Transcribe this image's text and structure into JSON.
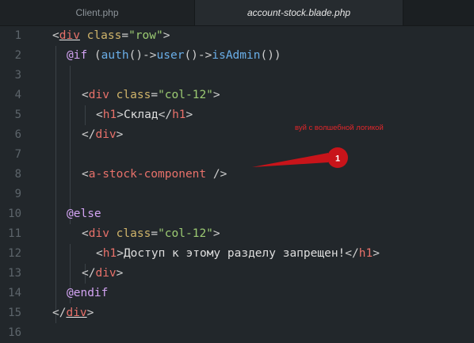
{
  "tabs": [
    {
      "label": "Client.php",
      "active": false
    },
    {
      "label": "account-stock.blade.php",
      "active": true
    }
  ],
  "line_numbers": [
    "1",
    "2",
    "3",
    "4",
    "5",
    "6",
    "7",
    "8",
    "9",
    "10",
    "11",
    "12",
    "13",
    "14",
    "15",
    "16"
  ],
  "code": {
    "l1": {
      "open": "<",
      "tag": "div",
      "sp": " ",
      "attr": "class",
      "eq": "=",
      "str": "\"row\"",
      "close": ">"
    },
    "l2": {
      "dir": "@if",
      "sp": " (",
      "fn1": "auth",
      "p1": "()->",
      "fn2": "user",
      "p2": "()->",
      "fn3": "isAdmin",
      "p3": "())"
    },
    "l4": {
      "open": "<",
      "tag": "div",
      "sp": " ",
      "attr": "class",
      "eq": "=",
      "str": "\"col-12\"",
      "close": ">"
    },
    "l5": {
      "open": "<",
      "tag": "h1",
      "close": ">",
      "text": "Склад",
      "open2": "</",
      "tag2": "h1",
      "close2": ">"
    },
    "l6": {
      "open": "</",
      "tag": "div",
      "close": ">"
    },
    "l8": {
      "open": "<",
      "tag": "a-stock-component",
      "close": " />"
    },
    "l10": {
      "dir": "@else"
    },
    "l11": {
      "open": "<",
      "tag": "div",
      "sp": " ",
      "attr": "class",
      "eq": "=",
      "str": "\"col-12\"",
      "close": ">"
    },
    "l12": {
      "open": "<",
      "tag": "h1",
      "close": ">",
      "text": "Доступ к этому разделу запрещен!",
      "open2": "</",
      "tag2": "h1",
      "close2": ">"
    },
    "l13": {
      "open": "</",
      "tag": "div",
      "close": ">"
    },
    "l14": {
      "dir": "@endif"
    },
    "l15": {
      "open": "</",
      "tag": "div",
      "close": ">"
    }
  },
  "annotation": {
    "text": "вуй с волшебной логикой",
    "marker_number": "1",
    "color": "#e2262a"
  }
}
